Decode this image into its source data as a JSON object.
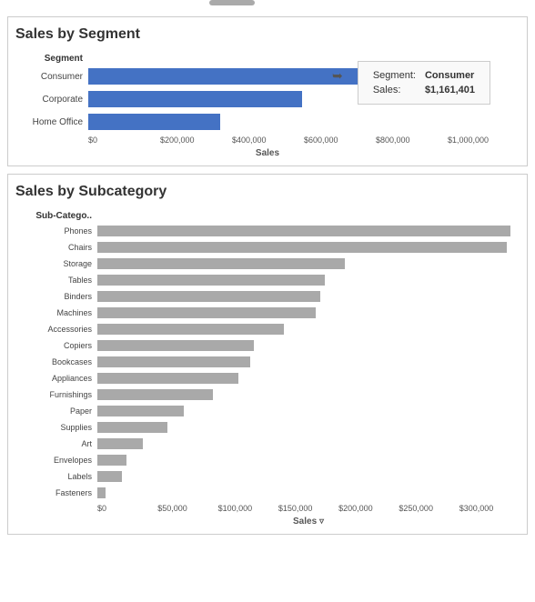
{
  "segment_chart": {
    "title": "Sales by Segment",
    "axis_column_label": "Segment",
    "axis_value_label": "Sales",
    "segments": [
      {
        "label": "Consumer",
        "value": 1161401,
        "bar_pct": 100,
        "highlighted": true
      },
      {
        "label": "Corporate",
        "value": 706146,
        "bar_pct": 60
      },
      {
        "label": "Home Office",
        "value": 429653,
        "bar_pct": 37
      }
    ],
    "x_ticks": [
      "$0",
      "$200,000",
      "$400,000",
      "$600,000",
      "$800,000",
      "$1,000,000"
    ],
    "tooltip": {
      "segment_label": "Segment:",
      "segment_value": "Consumer",
      "sales_label": "Sales:",
      "sales_value": "$1,161,401"
    }
  },
  "subcategory_chart": {
    "title": "Sales by Subcategory",
    "axis_column_label": "Sub-Catego..",
    "axis_value_label": "Sales",
    "subcategories": [
      {
        "label": "Phones",
        "bar_pct": 100
      },
      {
        "label": "Chairs",
        "bar_pct": 99
      },
      {
        "label": "Storage",
        "bar_pct": 60
      },
      {
        "label": "Tables",
        "bar_pct": 55
      },
      {
        "label": "Binders",
        "bar_pct": 54
      },
      {
        "label": "Machines",
        "bar_pct": 53
      },
      {
        "label": "Accessories",
        "bar_pct": 45
      },
      {
        "label": "Copiers",
        "bar_pct": 38
      },
      {
        "label": "Bookcases",
        "bar_pct": 37
      },
      {
        "label": "Appliances",
        "bar_pct": 34
      },
      {
        "label": "Furnishings",
        "bar_pct": 28
      },
      {
        "label": "Paper",
        "bar_pct": 21
      },
      {
        "label": "Supplies",
        "bar_pct": 17
      },
      {
        "label": "Art",
        "bar_pct": 11
      },
      {
        "label": "Envelopes",
        "bar_pct": 7
      },
      {
        "label": "Labels",
        "bar_pct": 6
      },
      {
        "label": "Fasteners",
        "bar_pct": 2
      }
    ],
    "x_ticks": [
      "$0",
      "$50,000",
      "$100,000",
      "$150,000",
      "$200,000",
      "$250,000",
      "$300,000"
    ]
  }
}
